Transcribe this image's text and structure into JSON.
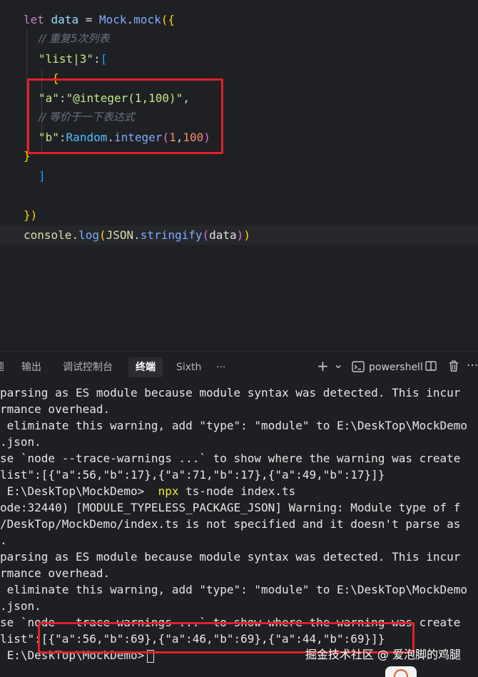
{
  "editor": {
    "lines": {
      "l1": {
        "kw": "let",
        "var": "data",
        "eq": "=",
        "obj": "Mock",
        "dot": ".",
        "fn": "mock",
        "open": "({"
      },
      "l2": {
        "comment": "// 重复5次列表"
      },
      "l3": {
        "key": "\"list|3\"",
        "colon": ":",
        "bracket": "["
      },
      "l4": {
        "brace": "{"
      },
      "l5": {
        "key": "\"a\"",
        "colon": ":",
        "value": "\"@integer(1,100)\"",
        "comma": ","
      },
      "l6": {
        "comment": "// 等价于一下表达式"
      },
      "l7": {
        "key": "\"b\"",
        "colon": ":",
        "cls": "Random",
        "dot": ".",
        "meth": "integer",
        "open": "(",
        "n1": "1",
        "sep": ",",
        "n2": "100",
        "close": ")"
      },
      "l8": {
        "brace": "}"
      },
      "l9": {
        "bracket": "]"
      },
      "l11": {
        "close": "})"
      },
      "l12": {
        "obj": "console",
        "dot": ".",
        "fn": "log",
        "open": "(",
        "json": "JSON",
        "dot2": ".",
        "fn2": "stringify",
        "open2": "(",
        "arg": "data",
        "close2": ")",
        "close": ")"
      }
    }
  },
  "panel": {
    "tabs": [
      {
        "label": "题"
      },
      {
        "label": "输出"
      },
      {
        "label": "调试控制台"
      },
      {
        "label": "终端"
      },
      {
        "label": "Sixth"
      },
      {
        "label": "···"
      }
    ],
    "add_icon": "+",
    "dropdown_icon": "⌄",
    "shell_icon": "terminal-icon",
    "shell_label": "powershell",
    "split_icon": "◫",
    "trash_icon": "🗑",
    "more_icon": "···"
  },
  "terminal": {
    "lines": [
      "parsing as ES module because module syntax was detected. This incur",
      "rmance overhead.",
      " eliminate this warning, add \"type\": \"module\" to E:\\DeskTop\\MockDemo",
      ".json.",
      "se `node --trace-warnings ...` to show where the warning was create",
      "list\":[{\"a\":56,\"b\":17},{\"a\":71,\"b\":17},{\"a\":49,\"b\":17}]}",
      "",
      "ode:32440) [MODULE_TYPELESS_PACKAGE_JSON] Warning: Module type of f",
      "/DeskTop/MockDemo/index.ts is not specified and it doesn't parse as",
      ".",
      "parsing as ES module because module syntax was detected. This incur",
      "rmance overhead.",
      " eliminate this warning, add \"type\": \"module\" to E:\\DeskTop\\MockDemo",
      ".json.",
      "se `node --trace-warnings ...` to show where the warning was create",
      "list\":[{\"a\":56,\"b\":69},{\"a\":46,\"b\":69},{\"a\":44,\"b\":69}]}"
    ],
    "prompt_line": {
      "prompt": " E:\\DeskTop\\MockDemo>",
      "cmd": "npx",
      "args": "ts-node index.ts"
    },
    "final_prompt": " E:\\DeskTop\\MockDemo>"
  },
  "watermark": "掘金技术社区 @ 爱泡脚的鸡腿",
  "colors": {
    "annotation": "#e3202a",
    "background": "#1e1f22"
  }
}
